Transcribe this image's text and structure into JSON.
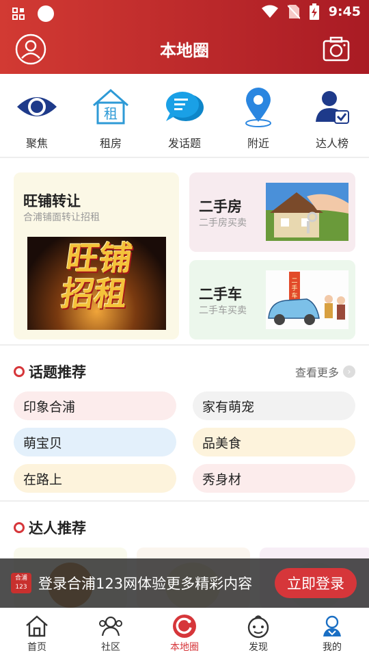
{
  "status": {
    "time": "9:45"
  },
  "header": {
    "title": "本地圈"
  },
  "quick_nav": [
    {
      "label": "聚焦",
      "icon": "eye-icon"
    },
    {
      "label": "租房",
      "icon": "house-rent-icon"
    },
    {
      "label": "发话题",
      "icon": "chat-bubble-icon"
    },
    {
      "label": "附近",
      "icon": "location-pin-icon"
    },
    {
      "label": "达人榜",
      "icon": "expert-badge-icon"
    }
  ],
  "cards": {
    "shop": {
      "title": "旺铺转让",
      "subtitle": "合浦铺面转让招租",
      "image_text_1": "旺铺",
      "image_text_2": "招租"
    },
    "house": {
      "title": "二手房",
      "subtitle": "二手房买卖"
    },
    "car": {
      "title": "二手车",
      "subtitle": "二手车买卖",
      "sign_text": "二手车"
    }
  },
  "topics": {
    "heading": "话题推荐",
    "more": "查看更多",
    "items": [
      {
        "label": "印象合浦",
        "color": "#fcecec"
      },
      {
        "label": "家有萌宠",
        "color": "#f2f2f2"
      },
      {
        "label": "萌宝贝",
        "color": "#e3f0fb"
      },
      {
        "label": "品美食",
        "color": "#fdf3dc"
      },
      {
        "label": "在路上",
        "color": "#fdf3dc"
      },
      {
        "label": "秀身材",
        "color": "#fcecec"
      }
    ]
  },
  "experts": {
    "heading": "达人推荐"
  },
  "login_banner": {
    "logo_line1": "合浦",
    "logo_line2": "123",
    "text": "登录合浦123网体验更多精彩内容",
    "button": "立即登录"
  },
  "tabbar": [
    {
      "label": "首页",
      "icon": "home-icon"
    },
    {
      "label": "社区",
      "icon": "community-icon"
    },
    {
      "label": "本地圈",
      "icon": "local-circle-icon",
      "active": true
    },
    {
      "label": "发现",
      "icon": "discover-icon"
    },
    {
      "label": "我的",
      "icon": "profile-icon"
    }
  ],
  "colors": {
    "brand": "#d6363a",
    "header_start": "#d23a33",
    "header_end": "#a91b24"
  }
}
